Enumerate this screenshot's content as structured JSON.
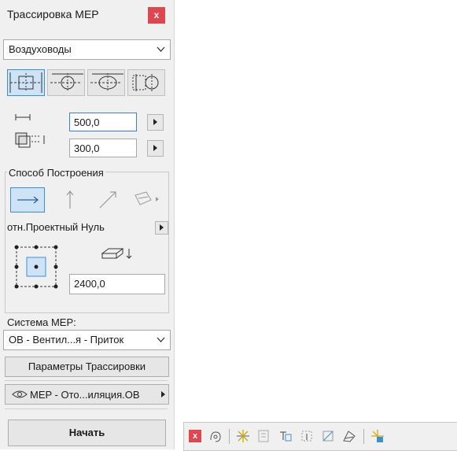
{
  "panel": {
    "title": "Трассировка MEP",
    "close_label": "x",
    "mep_type": "Воздуховоды",
    "shapes": [
      {
        "name": "rectangular-duct-icon",
        "active": true
      },
      {
        "name": "round-duct-icon",
        "active": false
      },
      {
        "name": "oval-duct-icon",
        "active": false
      },
      {
        "name": "rectangular-to-round-duct-icon",
        "active": false
      }
    ],
    "width_value": "500,0",
    "height_value": "300,0",
    "construction_method_label": "Способ Построения",
    "methods": [
      {
        "name": "horizontal-route-icon",
        "active": true
      },
      {
        "name": "vertical-route-icon",
        "active": false
      },
      {
        "name": "sloped-route-icon",
        "active": false
      },
      {
        "name": "custom-route-icon",
        "active": false
      }
    ],
    "reference_label": "отн.Проектный Нуль",
    "elevation_value": "2400,0",
    "mep_system_label": "Система MEP:",
    "mep_system_value": "ОВ - Вентил...я - Приток",
    "routing_params_label": "Параметры Трассировки",
    "layer_label": "MEP - Ото...иляция.ОВ",
    "start_label": "Начать",
    "accent_color": "#3a8fd9",
    "close_color": "#e0464e"
  },
  "toolbar": {
    "close_label": "x",
    "icons": [
      "route-settings-icon",
      "split-icon",
      "disconnect-icon",
      "connect-icon",
      "align-icon",
      "slope-icon",
      "angle-icon",
      "finish-icon"
    ]
  }
}
